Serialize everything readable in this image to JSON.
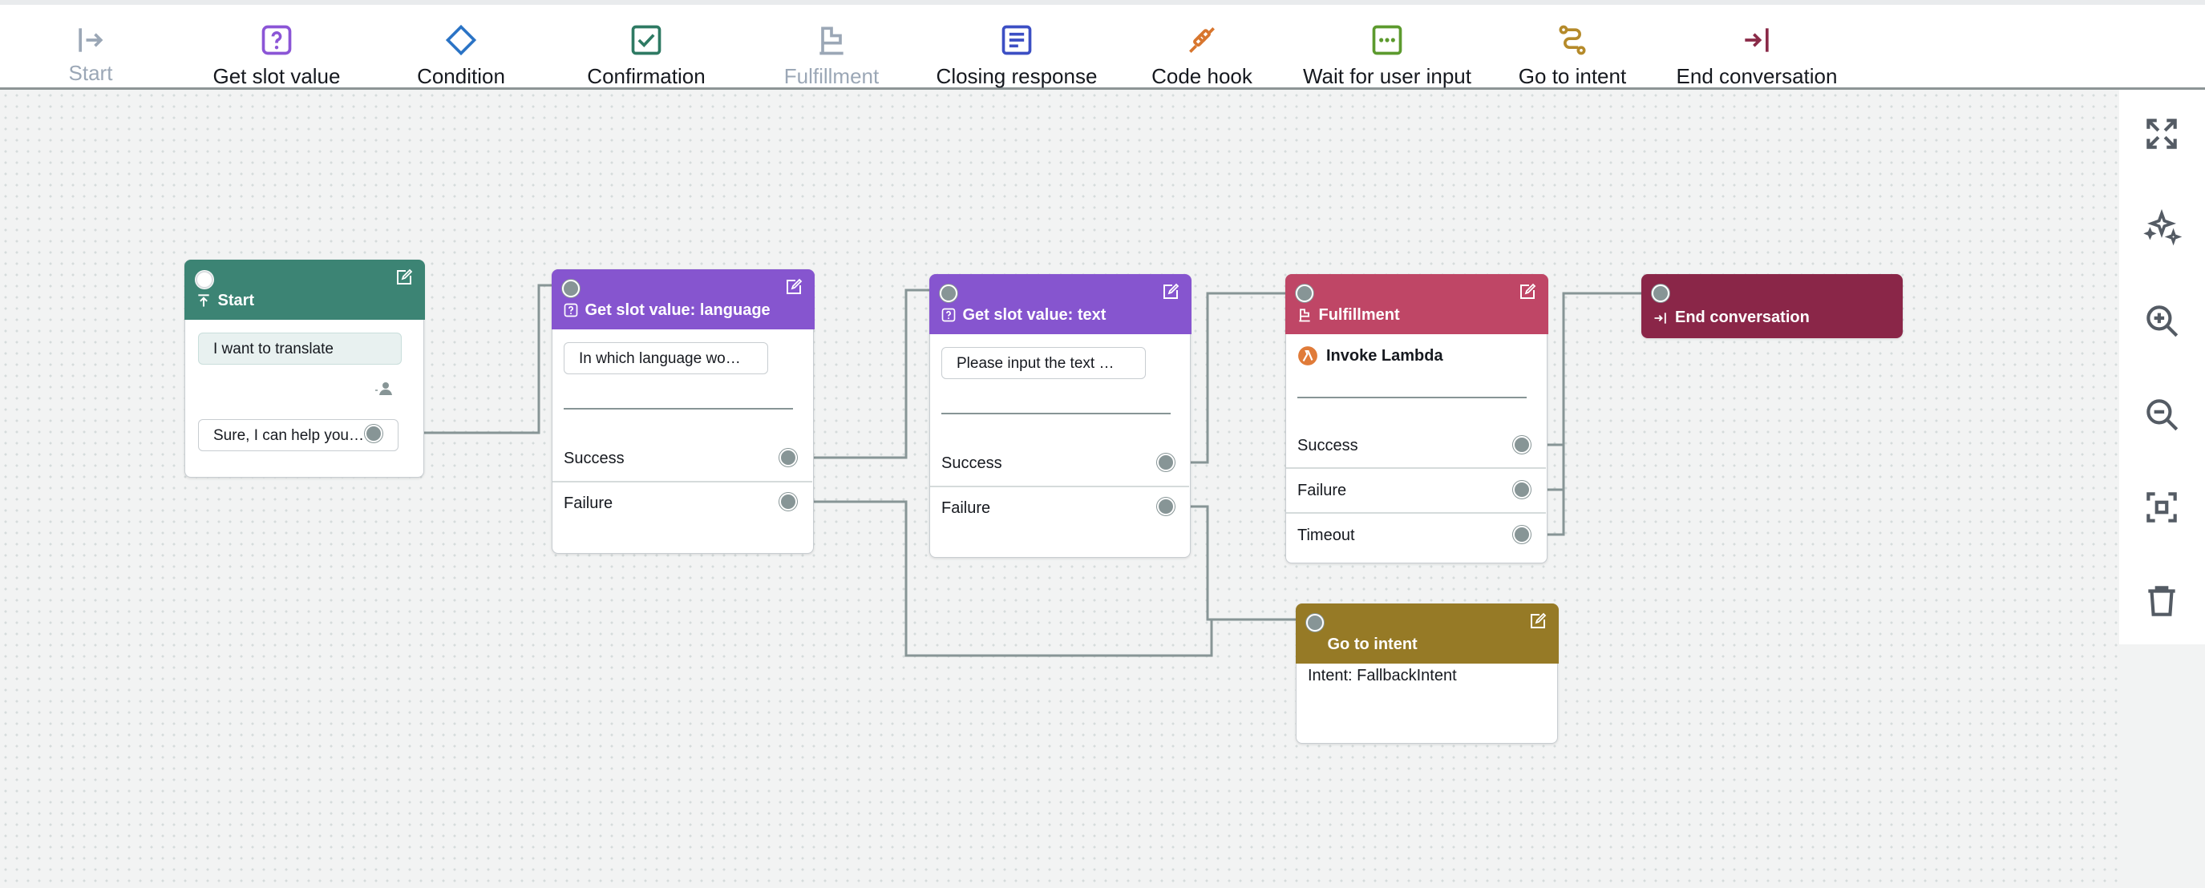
{
  "toolbar": {
    "items": [
      {
        "label": "Start",
        "icon": "start-icon",
        "color": "#9ba7b6",
        "disabled": true
      },
      {
        "label": "Get slot value",
        "icon": "question-square-icon",
        "color": "#8b55d6",
        "disabled": false
      },
      {
        "label": "Condition",
        "icon": "diamond-icon",
        "color": "#2a73c5",
        "disabled": false
      },
      {
        "label": "Confirmation",
        "icon": "check-square-icon",
        "color": "#2e7a63",
        "disabled": false
      },
      {
        "label": "Fulfillment",
        "icon": "flag-icon",
        "color": "#9ba7b6",
        "disabled": true
      },
      {
        "label": "Closing response",
        "icon": "document-icon",
        "color": "#3c4fc4",
        "disabled": false
      },
      {
        "label": "Code hook",
        "icon": "plug-icon",
        "color": "#d8762e",
        "disabled": false
      },
      {
        "label": "Wait for user input",
        "icon": "dots-square-icon",
        "color": "#5c9a2e",
        "disabled": false
      },
      {
        "label": "Go to intent",
        "icon": "route-icon",
        "color": "#b58a2a",
        "disabled": false
      },
      {
        "label": "End conversation",
        "icon": "end-icon",
        "color": "#8a2a48",
        "disabled": false
      }
    ]
  },
  "side_tools": [
    {
      "name": "fit-view-icon"
    },
    {
      "name": "auto-arrange-icon"
    },
    {
      "name": "zoom-in-icon"
    },
    {
      "name": "zoom-out-icon"
    },
    {
      "name": "focus-frame-icon"
    },
    {
      "name": "trash-icon"
    }
  ],
  "colors": {
    "start": "#3c8474",
    "slot": "#8655cf",
    "fulfillment": "#bf4666",
    "end": "#8a2648",
    "goto": "#967a26",
    "wire": "#879596"
  },
  "nodes": {
    "start": {
      "title": "Start",
      "user_utterance": "I want to translate",
      "bot_response": "Sure, I can help you…"
    },
    "slot_language": {
      "title": "Get slot value: language",
      "prompt": "In which language wo…",
      "success": "Success",
      "failure": "Failure"
    },
    "slot_text": {
      "title": "Get slot value: text",
      "prompt": "Please input the text …",
      "success": "Success",
      "failure": "Failure"
    },
    "fulfillment": {
      "title": "Fulfillment",
      "lambda": "Invoke Lambda",
      "success": "Success",
      "failure": "Failure",
      "timeout": "Timeout"
    },
    "end": {
      "title": "End conversation"
    },
    "goto": {
      "title": "Go to intent",
      "intent": "Intent: FallbackIntent"
    }
  }
}
